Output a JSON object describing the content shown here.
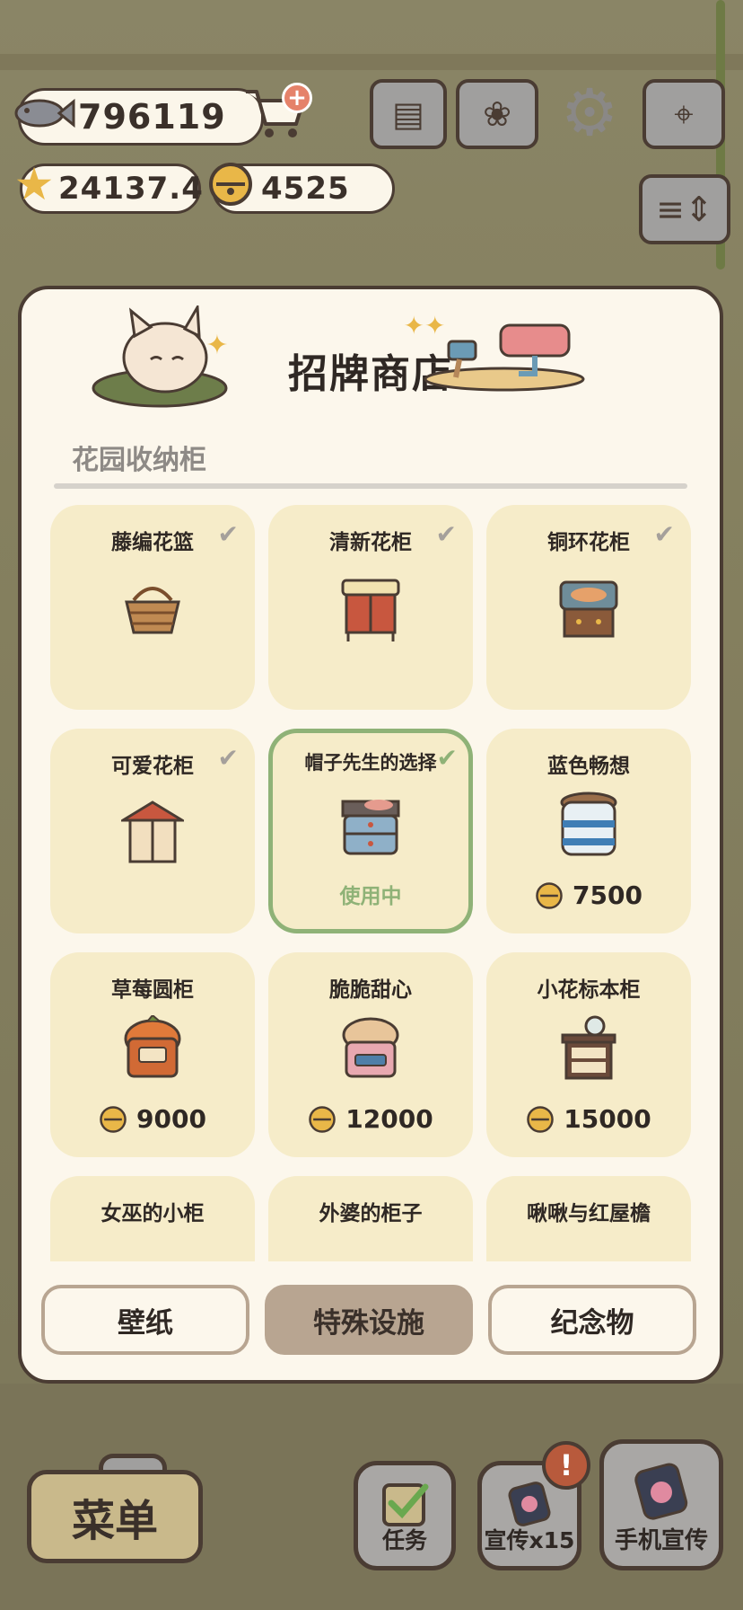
{
  "currency": {
    "fish": "796119",
    "stars": "24137.4",
    "bells": "4525"
  },
  "shop": {
    "title": "招牌商店",
    "category": "花园收纳柜",
    "items": [
      {
        "name": "藤编花篮",
        "owned": true,
        "price": "",
        "status": ""
      },
      {
        "name": "清新花柜",
        "owned": true,
        "price": "",
        "status": ""
      },
      {
        "name": "铜环花柜",
        "owned": true,
        "price": "",
        "status": ""
      },
      {
        "name": "可爱花柜",
        "owned": true,
        "price": "",
        "status": ""
      },
      {
        "name": "帽子先生的选择",
        "owned": true,
        "price": "",
        "status": "使用中"
      },
      {
        "name": "蓝色畅想",
        "owned": false,
        "price": "7500",
        "status": ""
      },
      {
        "name": "草莓圆柜",
        "owned": false,
        "price": "9000",
        "status": ""
      },
      {
        "name": "脆脆甜心",
        "owned": false,
        "price": "12000",
        "status": ""
      },
      {
        "name": "小花标本柜",
        "owned": false,
        "price": "15000",
        "status": ""
      },
      {
        "name": "女巫的小柜",
        "owned": false,
        "price": "",
        "status": ""
      },
      {
        "name": "外婆的柜子",
        "owned": false,
        "price": "",
        "status": ""
      },
      {
        "name": "啾啾与红屋檐",
        "owned": false,
        "price": "",
        "status": ""
      }
    ],
    "tabs": [
      "壁纸",
      "特殊设施",
      "纪念物"
    ],
    "selected_tab": "特殊设施"
  },
  "bottom": {
    "menu": "菜单",
    "tasks": "任务",
    "promote": "宣传x15",
    "phone_promote": "手机宣传",
    "notify_badge": "!"
  },
  "colors": {
    "active_border": "#8fb277",
    "card_bg": "#f6ecc9",
    "selected_tab": "#b8a591"
  }
}
